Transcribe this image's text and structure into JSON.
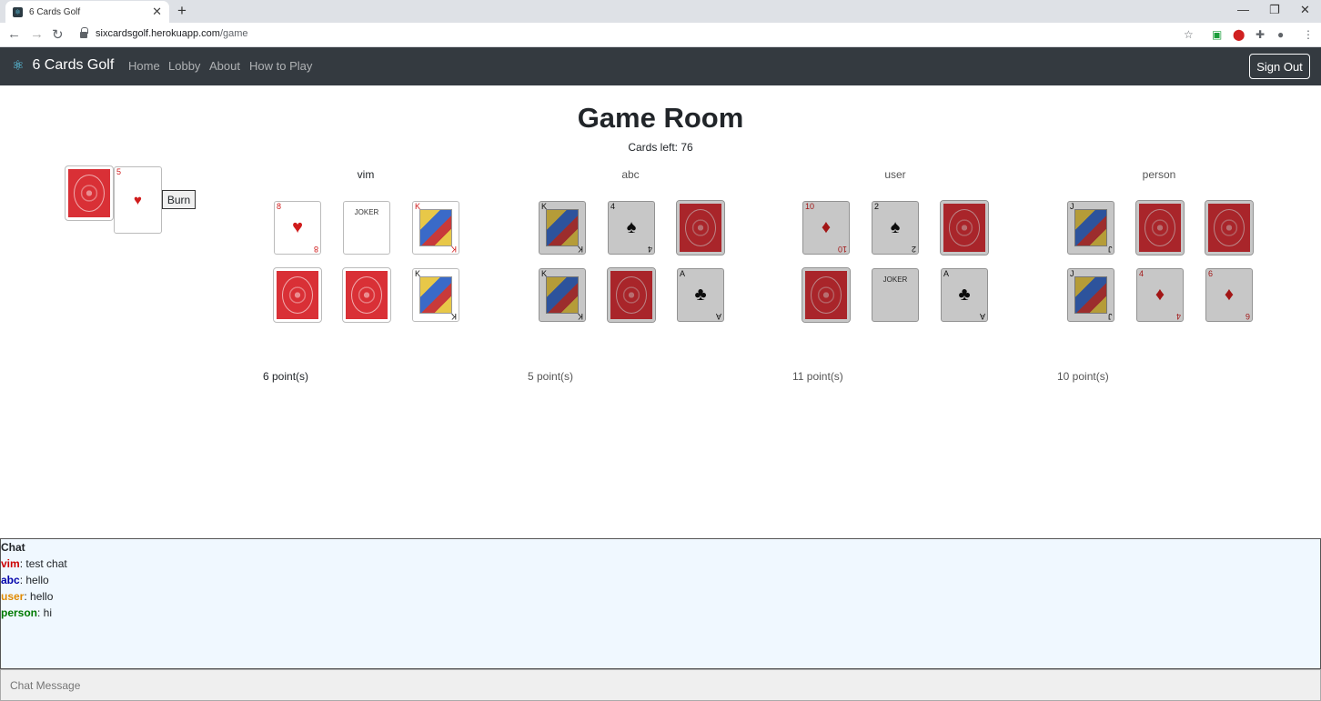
{
  "browser": {
    "tab_title": "6 Cards Golf",
    "url_host": "sixcardsgolf.herokuapp.com",
    "url_path": "/game"
  },
  "navbar": {
    "brand": "6 Cards Golf",
    "links": [
      "Home",
      "Lobby",
      "About",
      "How to Play"
    ],
    "sign_out": "Sign Out"
  },
  "game": {
    "title": "Game Room",
    "cards_left": "Cards left: 76",
    "burn_label": "Burn",
    "deck": {
      "draw_pile": "back",
      "discard": {
        "rank": "5",
        "suit": "♥",
        "color": "red"
      }
    },
    "players": [
      {
        "name": "vim",
        "points": "6 point(s)",
        "cards": [
          {
            "rank": "8",
            "suit": "♥",
            "color": "red"
          },
          {
            "rank": "JOKER",
            "suit": "",
            "color": "black"
          },
          {
            "rank": "K",
            "suit": "♥",
            "color": "red"
          },
          {
            "rank": "",
            "suit": "",
            "color": "back"
          },
          {
            "rank": "",
            "suit": "",
            "color": "back"
          },
          {
            "rank": "K",
            "suit": "♣",
            "color": "black"
          }
        ]
      },
      {
        "name": "abc",
        "points": "5 point(s)",
        "cards": [
          {
            "rank": "K",
            "suit": "♠",
            "color": "black"
          },
          {
            "rank": "4",
            "suit": "♠",
            "color": "black"
          },
          {
            "rank": "",
            "suit": "",
            "color": "back"
          },
          {
            "rank": "K",
            "suit": "♣",
            "color": "black"
          },
          {
            "rank": "",
            "suit": "",
            "color": "back"
          },
          {
            "rank": "A",
            "suit": "♣",
            "color": "black"
          }
        ]
      },
      {
        "name": "user",
        "points": "11 point(s)",
        "cards": [
          {
            "rank": "10",
            "suit": "♦",
            "color": "red"
          },
          {
            "rank": "2",
            "suit": "♠",
            "color": "black"
          },
          {
            "rank": "",
            "suit": "",
            "color": "back"
          },
          {
            "rank": "",
            "suit": "",
            "color": "back"
          },
          {
            "rank": "JOKER",
            "suit": "",
            "color": "black"
          },
          {
            "rank": "A",
            "suit": "♣",
            "color": "black"
          }
        ]
      },
      {
        "name": "person",
        "points": "10 point(s)",
        "cards": [
          {
            "rank": "J",
            "suit": "♠",
            "color": "black"
          },
          {
            "rank": "",
            "suit": "",
            "color": "back"
          },
          {
            "rank": "",
            "suit": "",
            "color": "back"
          },
          {
            "rank": "J",
            "suit": "♣",
            "color": "black"
          },
          {
            "rank": "4",
            "suit": "♦",
            "color": "red"
          },
          {
            "rank": "6",
            "suit": "♦",
            "color": "red"
          }
        ]
      }
    ]
  },
  "chat": {
    "title": "Chat",
    "messages": [
      {
        "user": "vim",
        "text": ": test chat",
        "color": "#cc0000"
      },
      {
        "user": "abc",
        "text": ": hello",
        "color": "#0000aa"
      },
      {
        "user": "user",
        "text": ": hello",
        "color": "#e08a00"
      },
      {
        "user": "person",
        "text": ": hi",
        "color": "#007a00"
      }
    ],
    "input_placeholder": "Chat Message"
  }
}
